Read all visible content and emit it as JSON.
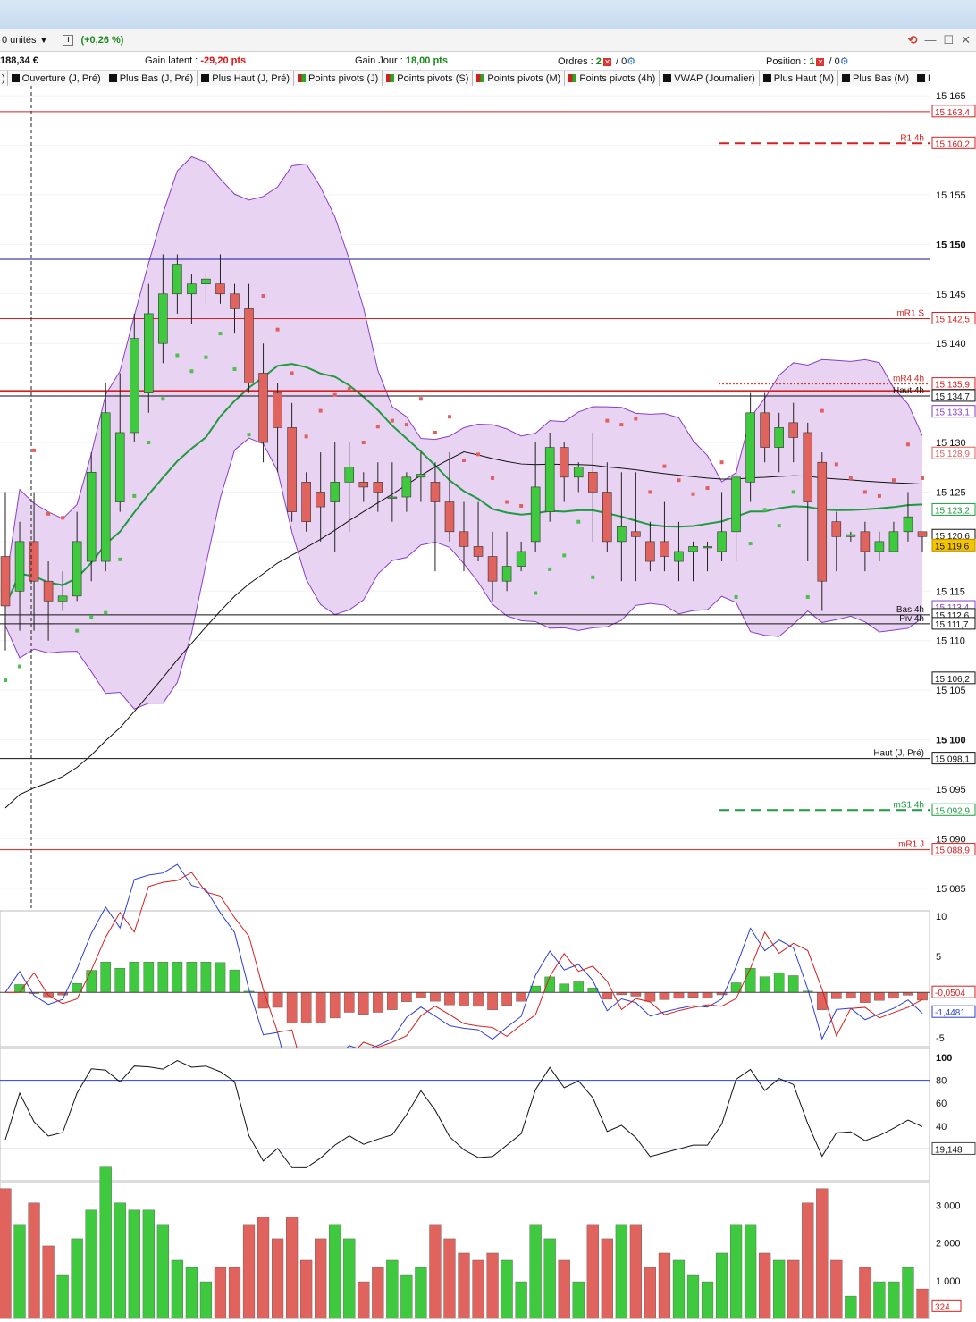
{
  "toolbar": {
    "units": "0 unités",
    "change_pct": "(+0,26 %)"
  },
  "status": {
    "account": "188,34 €",
    "latent_label": "Gain latent :",
    "latent_value": "-29,20 pts",
    "day_label": "Gain Jour :",
    "day_value": "18,00 pts",
    "orders_label": "Ordres :",
    "orders_count": "2",
    "orders_zero": "/ 0",
    "position_label": "Position :",
    "position_count": "1",
    "position_zero": "/ 0"
  },
  "tabs": [
    {
      "label": "Ouverture (J, Pré)",
      "kind": "plain"
    },
    {
      "label": "Plus Bas (J, Pré)",
      "kind": "plain"
    },
    {
      "label": "Plus Haut (J, Pré)",
      "kind": "plain"
    },
    {
      "label": "Points pivots (J)",
      "kind": "pivot"
    },
    {
      "label": "Points pivots (S)",
      "kind": "pivot"
    },
    {
      "label": "Points pivots (M)",
      "kind": "pivot"
    },
    {
      "label": "Points pivots (4h)",
      "kind": "pivot"
    },
    {
      "label": "VWAP (Journalier)",
      "kind": "plain"
    },
    {
      "label": "Plus Haut (M)",
      "kind": "plain"
    },
    {
      "label": "Plus Bas (M)",
      "kind": "plain"
    },
    {
      "label": "Plus B",
      "kind": "plain"
    }
  ],
  "colors": {
    "bull": "#3ec93e",
    "bear": "#e0635d",
    "band": "#e9d3f2",
    "bandline": "#8a3ec4",
    "ma": "#1e9a40",
    "psar": "#4cc04c",
    "psar_bear": "#e06060",
    "blue": "#1010a0",
    "red": "#d42020"
  },
  "chart_data": {
    "type": "candlestick",
    "price_axis": {
      "min": 15083,
      "max": 15166,
      "ticks": [
        "15 165",
        "15 155",
        "15 150",
        "15 145",
        "15 140",
        "15 130",
        "15 125",
        "15 115",
        "15 110",
        "15 105",
        "15 100",
        "15 095",
        "15 090",
        "15 085"
      ]
    },
    "levels": [
      {
        "price": 15163.4,
        "label": "",
        "value": "15 163,4",
        "color": "#d42020",
        "style": "solid"
      },
      {
        "price": 15160.2,
        "label": "R1 4h",
        "value": "15 160,2",
        "color": "#d42020",
        "style": "dashed"
      },
      {
        "price": 15148.5,
        "label": "",
        "value": "",
        "color": "#1010a0",
        "style": "solid"
      },
      {
        "price": 15142.5,
        "label": "mR1 S",
        "value": "15 142,5",
        "color": "#d42020",
        "style": "solid"
      },
      {
        "price": 15135.9,
        "label": "mR4 4h",
        "value": "15 135,9",
        "color": "#d42020",
        "style": "dotted"
      },
      {
        "price": 15135.2,
        "label": "",
        "value": "",
        "color": "#d42020",
        "style": "thick"
      },
      {
        "price": 15134.7,
        "label": "Haut 4h",
        "value": "15 134,7",
        "color": "#111111",
        "style": "solid"
      },
      {
        "price": 15133.1,
        "label": "",
        "value": "15 133,1",
        "color": "#8a3ec4",
        "style": "none"
      },
      {
        "price": 15128.9,
        "label": "",
        "value": "15 128,9",
        "color": "#e06060",
        "style": "none"
      },
      {
        "price": 15123.2,
        "label": "",
        "value": "15 123,2",
        "color": "#1e9a40",
        "style": "none"
      },
      {
        "price": 15120.6,
        "label": "",
        "value": "15 120,6",
        "color": "#111111",
        "style": "none"
      },
      {
        "price": 15113.4,
        "label": "",
        "value": "15 113,4",
        "color": "#8a3ec4",
        "style": "none"
      },
      {
        "price": 15112.6,
        "label": "Bas 4h",
        "value": "15 112,6",
        "color": "#111111",
        "style": "solid"
      },
      {
        "price": 15111.7,
        "label": "Piv 4h",
        "value": "15 111,7",
        "color": "#111111",
        "style": "solid"
      },
      {
        "price": 15106.2,
        "label": "",
        "value": "15 106,2",
        "color": "#111111",
        "style": "none"
      },
      {
        "price": 15098.1,
        "label": "Haut (J, Pré)",
        "value": "15 098,1",
        "color": "#111111",
        "style": "solid"
      },
      {
        "price": 15092.9,
        "label": "mS1 4h",
        "value": "15 092,9",
        "color": "#1e9a40",
        "style": "dashed"
      },
      {
        "price": 15088.9,
        "label": "mR1 J",
        "value": "15 088,9",
        "color": "#d42020",
        "style": "solid"
      }
    ],
    "last_price": "15 119,6",
    "candles": [
      [
        15118.5,
        15125,
        15109,
        15113.5
      ],
      [
        15115,
        15122,
        15111,
        15120
      ],
      [
        15120,
        15125,
        15111,
        15116
      ],
      [
        15116,
        15118,
        15110,
        15114
      ],
      [
        15114,
        15117,
        15113,
        15114.5
      ],
      [
        15114.5,
        15123,
        15114,
        15120
      ],
      [
        15118,
        15129,
        15116,
        15127
      ],
      [
        15118,
        15136,
        15117,
        15133
      ],
      [
        15124,
        15137,
        15123,
        15131
      ],
      [
        15131,
        15143,
        15130,
        15140.5
      ],
      [
        15135,
        15146,
        15133,
        15143
      ],
      [
        15140,
        15149,
        15138,
        15145
      ],
      [
        15145,
        15149,
        15143,
        15148
      ],
      [
        15145,
        15147,
        15142,
        15146
      ],
      [
        15146,
        15147,
        15144,
        15146.5
      ],
      [
        15146,
        15149,
        15144,
        15145
      ],
      [
        15145,
        15146,
        15141,
        15143.5
      ],
      [
        15143.5,
        15146,
        15135,
        15136
      ],
      [
        15137,
        15140,
        15128,
        15130
      ],
      [
        15135,
        15136,
        15127,
        15131.5
      ],
      [
        15131.5,
        15134,
        15122,
        15123
      ],
      [
        15126,
        15127,
        15121,
        15122
      ],
      [
        15125,
        15129,
        15120,
        15123.5
      ],
      [
        15124,
        15130,
        15119,
        15126
      ],
      [
        15126,
        15130,
        15121,
        15127.5
      ],
      [
        15126,
        15127,
        15124,
        15125.5
      ],
      [
        15126,
        15128,
        15123,
        15125
      ],
      [
        15124.5,
        15128,
        15122,
        15124.5
      ],
      [
        15124.5,
        15127,
        15123,
        15126.5
      ],
      [
        15126.5,
        15129,
        15124,
        15126.8
      ],
      [
        15126,
        15128,
        15117,
        15124
      ],
      [
        15124,
        15129,
        15120,
        15121
      ],
      [
        15121,
        15124,
        15117,
        15119.5
      ],
      [
        15119.5,
        15124,
        15118,
        15118.5
      ],
      [
        15118.5,
        15121,
        15114,
        15116
      ],
      [
        15116,
        15121,
        15115,
        15117.5
      ],
      [
        15117.5,
        15120,
        15117,
        15119
      ],
      [
        15120,
        15130,
        15119,
        15125.5
      ],
      [
        15123,
        15131,
        15122,
        15129.5
      ],
      [
        15129.5,
        15130,
        15124,
        15126.5
      ],
      [
        15126.5,
        15128,
        15125,
        15127.5
      ],
      [
        15127,
        15131,
        15120,
        15125
      ],
      [
        15125,
        15128,
        15119,
        15120
      ],
      [
        15120,
        15127,
        15116,
        15121.5
      ],
      [
        15121,
        15127,
        15116,
        15120.5
      ],
      [
        15120,
        15122,
        15117,
        15118
      ],
      [
        15120,
        15124,
        15117,
        15118.5
      ],
      [
        15118,
        15122,
        15116,
        15119
      ],
      [
        15119,
        15120,
        15116,
        15119.5
      ],
      [
        15119.5,
        15120,
        15117,
        15119.5
      ],
      [
        15119,
        15125,
        15118,
        15121
      ],
      [
        15121,
        15129,
        15118,
        15126.5
      ],
      [
        15126,
        15135,
        15124,
        15133
      ],
      [
        15133,
        15135,
        15128,
        15129.5
      ],
      [
        15129.5,
        15133,
        15127,
        15131.5
      ],
      [
        15132,
        15134,
        15128,
        15130.5
      ],
      [
        15131,
        15132,
        15118,
        15124
      ],
      [
        15128,
        15129,
        15113,
        15116
      ],
      [
        15122,
        15123,
        15117,
        15120.5
      ],
      [
        15120.5,
        15121,
        15120,
        15120.7
      ],
      [
        15121,
        15122,
        15117,
        15119
      ],
      [
        15119,
        15121,
        15118,
        15120
      ],
      [
        15119,
        15122,
        15119,
        15121
      ],
      [
        15121,
        15125,
        15120,
        15122.5
      ],
      [
        15121,
        15121,
        15119,
        15120.5
      ]
    ],
    "macd": {
      "axis": [
        "10",
        "5",
        "-5"
      ],
      "labels": [
        "-0,0504",
        "-1,4481"
      ]
    },
    "stoch": {
      "axis": [
        "100",
        "80",
        "60",
        "40"
      ],
      "label": "19,148"
    },
    "volume": {
      "axis": [
        "3 000",
        "2 000",
        "1 000"
      ],
      "label": "324"
    }
  }
}
